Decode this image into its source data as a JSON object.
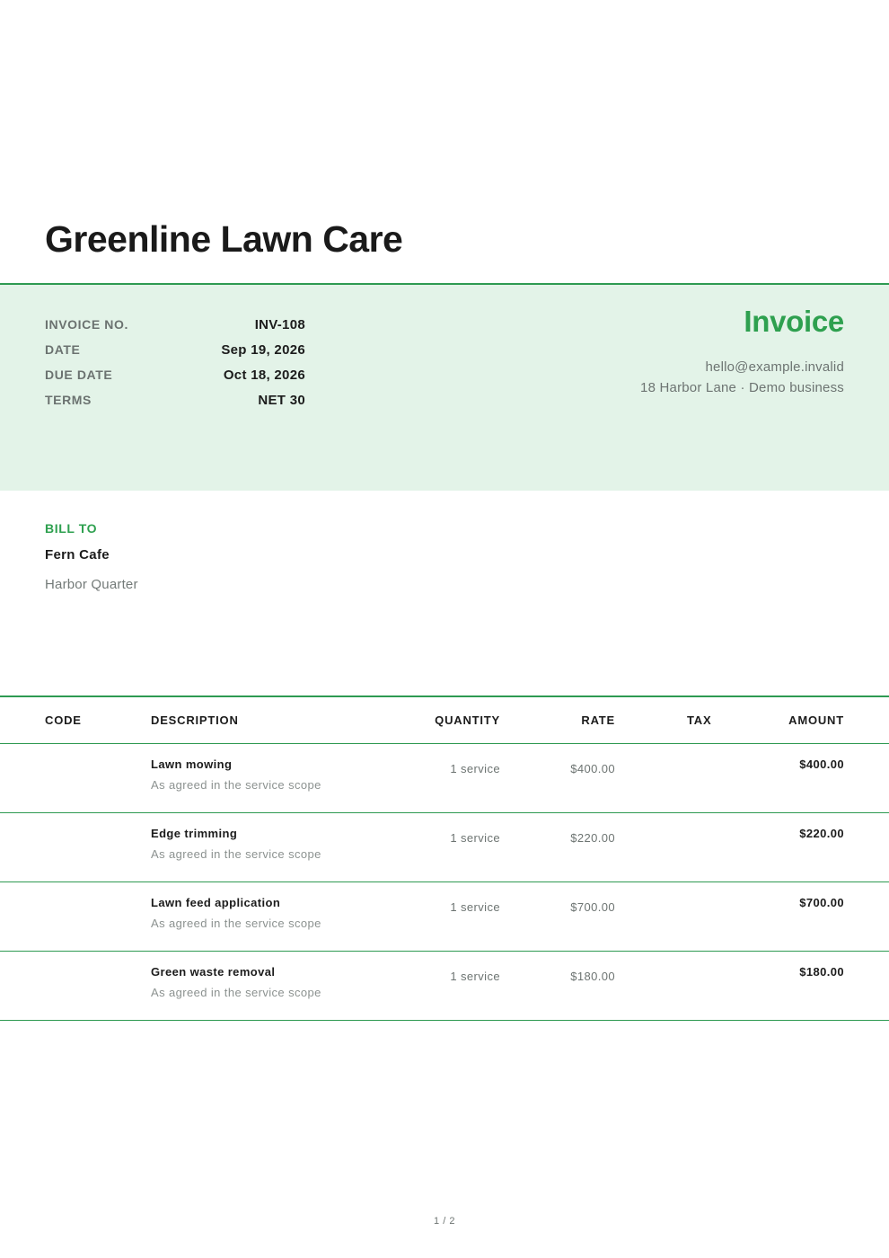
{
  "company": {
    "name": "Greenline Lawn Care"
  },
  "meta": [
    {
      "label": "INVOICE NO.",
      "value": "INV-108"
    },
    {
      "label": "DATE",
      "value": "Sep 19, 2026"
    },
    {
      "label": "DUE DATE",
      "value": "Oct 18, 2026"
    },
    {
      "label": "TERMS",
      "value": "NET 30"
    }
  ],
  "document": {
    "title": "Invoice"
  },
  "sender": {
    "email": "hello@example.invalid",
    "address": "18 Harbor Lane · Demo business"
  },
  "bill_to": {
    "label": "BILL TO",
    "name": "Fern Cafe",
    "address": "Harbor Quarter"
  },
  "table": {
    "headers": {
      "code": "CODE",
      "description": "DESCRIPTION",
      "quantity": "QUANTITY",
      "rate": "RATE",
      "tax": "TAX",
      "amount": "AMOUNT"
    },
    "rows": [
      {
        "code": "",
        "name": "Lawn mowing",
        "note": "As agreed in the service scope",
        "quantity": "1 service",
        "rate": "$400.00",
        "tax": "",
        "amount": "$400.00"
      },
      {
        "code": "",
        "name": "Edge trimming",
        "note": "As agreed in the service scope",
        "quantity": "1 service",
        "rate": "$220.00",
        "tax": "",
        "amount": "$220.00"
      },
      {
        "code": "",
        "name": "Lawn feed application",
        "note": "As agreed in the service scope",
        "quantity": "1 service",
        "rate": "$700.00",
        "tax": "",
        "amount": "$700.00"
      },
      {
        "code": "",
        "name": "Green waste removal",
        "note": "As agreed in the service scope",
        "quantity": "1 service",
        "rate": "$180.00",
        "tax": "",
        "amount": "$180.00"
      }
    ]
  },
  "footer": {
    "page": "1 / 2"
  },
  "colors": {
    "accent": "#2ea04f",
    "band": "#e3f3e8"
  }
}
